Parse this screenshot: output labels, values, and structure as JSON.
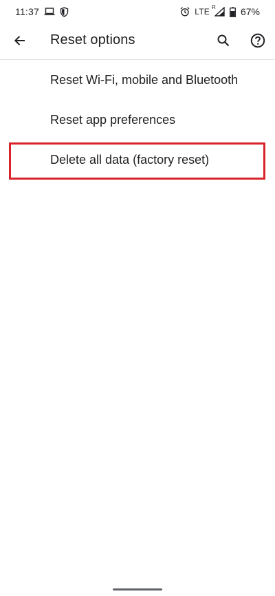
{
  "status_bar": {
    "time": "11:37",
    "network": "LTE",
    "signal_sup": "R",
    "battery": "67%"
  },
  "app_bar": {
    "title": "Reset options"
  },
  "menu": {
    "items": [
      {
        "label": "Reset Wi-Fi, mobile and Bluetooth"
      },
      {
        "label": "Reset app preferences"
      },
      {
        "label": "Delete all data (factory reset)"
      }
    ]
  },
  "colors": {
    "highlight": "#d8232a",
    "text": "#202124",
    "background": "#ffffff"
  },
  "icons": {
    "back": "arrow-back-icon",
    "search": "search-icon",
    "help": "help-circle-icon",
    "cast": "laptop-icon",
    "shield": "shield-icon",
    "alarm": "alarm-icon",
    "signal": "signal-icon",
    "battery": "battery-icon"
  }
}
